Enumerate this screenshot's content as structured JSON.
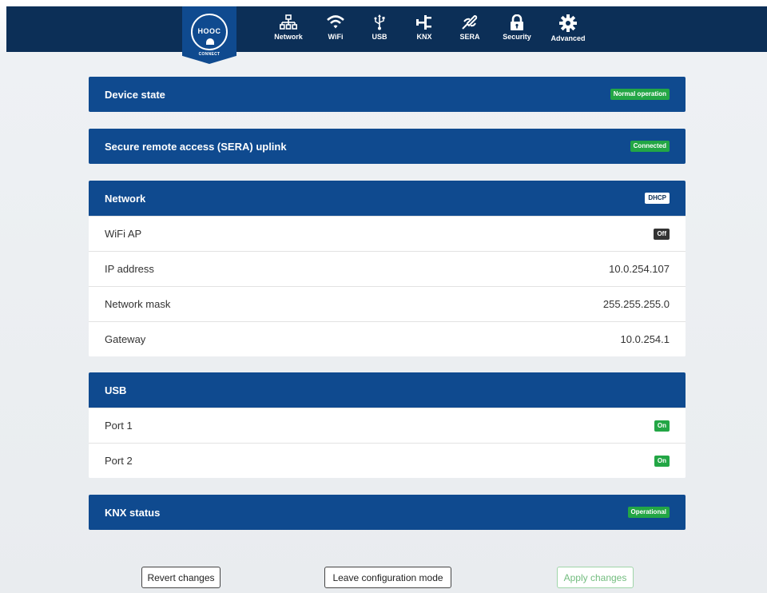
{
  "logo": {
    "text": "HOOC",
    "subtext": "CONNECT"
  },
  "nav": [
    {
      "label": "Network",
      "icon": "network-icon"
    },
    {
      "label": "WiFi",
      "icon": "wifi-icon"
    },
    {
      "label": "USB",
      "icon": "usb-icon"
    },
    {
      "label": "KNX",
      "icon": "knx-icon"
    },
    {
      "label": "SERA",
      "icon": "sera-icon"
    },
    {
      "label": "Security",
      "icon": "lock-icon"
    },
    {
      "label": "Advanced",
      "icon": "gear-icon"
    }
  ],
  "device_state": {
    "title": "Device state",
    "badge": "Normal operation"
  },
  "sera": {
    "title": "Secure remote access (SERA) uplink",
    "badge": "Connected"
  },
  "network": {
    "title": "Network",
    "badge": "DHCP",
    "rows": [
      {
        "label": "WiFi AP",
        "value": "Off"
      },
      {
        "label": "IP address",
        "value": "10.0.254.107"
      },
      {
        "label": "Network mask",
        "value": "255.255.255.0"
      },
      {
        "label": "Gateway",
        "value": "10.0.254.1"
      }
    ]
  },
  "usb": {
    "title": "USB",
    "rows": [
      {
        "label": "Port 1",
        "value": "On"
      },
      {
        "label": "Port 2",
        "value": "On"
      }
    ]
  },
  "knx": {
    "title": "KNX status",
    "badge": "Operational"
  },
  "buttons": {
    "revert": "Revert changes",
    "leave": "Leave configuration mode",
    "apply": "Apply changes"
  },
  "colors": {
    "topbar": "#0c2f57",
    "header": "#0f4a8f",
    "green": "#23a645"
  }
}
